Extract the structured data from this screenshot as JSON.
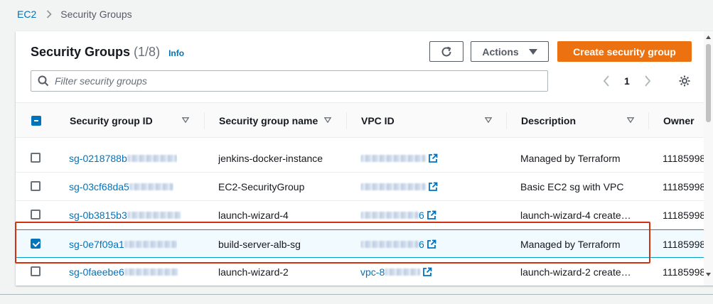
{
  "breadcrumb": {
    "root": "EC2",
    "current": "Security Groups"
  },
  "header": {
    "title": "Security Groups",
    "count": "(1/8)",
    "info": "Info"
  },
  "toolbar": {
    "actions_label": "Actions",
    "create_label": "Create security group"
  },
  "search": {
    "placeholder": "Filter security groups",
    "value": ""
  },
  "pagination": {
    "page": "1"
  },
  "table": {
    "columns": {
      "sg_id": "Security group ID",
      "sg_name": "Security group name",
      "vpc_id": "VPC ID",
      "description": "Description",
      "owner": "Owner"
    },
    "header_checkbox": "indeterminate",
    "rows": [
      {
        "sg_id": "sg-0218788b",
        "sg_name": "jenkins-docker-instance",
        "vpc_id": "",
        "description": "Managed by Terraform",
        "owner": "11185998",
        "selected": false
      },
      {
        "sg_id": "sg-03cf68da5",
        "sg_name": "EC2-SecurityGroup",
        "vpc_id": "",
        "description": "Basic EC2 sg with VPC",
        "owner": "11185998",
        "selected": false
      },
      {
        "sg_id": "sg-0b3815b3",
        "sg_name": "launch-wizard-4",
        "vpc_id": "6",
        "description": "launch-wizard-4 create…",
        "owner": "11185998",
        "selected": false
      },
      {
        "sg_id": "sg-0e7f09a1",
        "sg_name": "build-server-alb-sg",
        "vpc_id": "6",
        "description": "Managed by Terraform",
        "owner": "11185998",
        "selected": true
      },
      {
        "sg_id": "sg-0faeebe6",
        "sg_name": "launch-wizard-2",
        "vpc_id": "vpc-8",
        "description": "launch-wizard-2 create…",
        "owner": "11185998",
        "selected": false
      }
    ]
  },
  "colors": {
    "accent": "#0073bb",
    "primary_button": "#ec7211",
    "highlight_box": "#d13212"
  },
  "icons": {
    "refresh": "refresh-icon",
    "search": "search-icon",
    "settings": "gear-icon",
    "external": "external-link-icon"
  }
}
